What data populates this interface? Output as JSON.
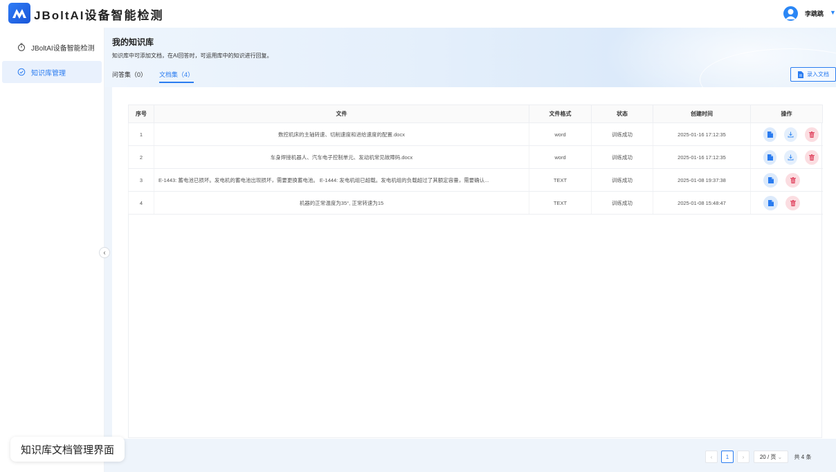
{
  "app": {
    "title": "JBoltAI设备智能检测"
  },
  "user": {
    "name": "李跳跳"
  },
  "sidebar": {
    "items": [
      {
        "label": "JBoltAI设备智能检测",
        "icon": "timer-icon"
      },
      {
        "label": "知识库管理",
        "icon": "knowledge-icon"
      }
    ]
  },
  "page": {
    "title": "我的知识库",
    "description": "知识库中可添加文档，在AI回答时，可运用库中的知识进行回复。",
    "tabs": [
      {
        "label": "问答集（0）"
      },
      {
        "label": "文档集（4）"
      }
    ],
    "import_label": "录入文档"
  },
  "table": {
    "headers": [
      "序号",
      "文件",
      "文件格式",
      "状态",
      "创建时间",
      "操作"
    ],
    "rows": [
      {
        "index": "1",
        "file": "数控机床的主轴转速、切削速度和进给速度的配置.docx",
        "format": "word",
        "status": "训练成功",
        "created": "2025-01-16 17:12:35",
        "ops": [
          "view",
          "download",
          "delete"
        ]
      },
      {
        "index": "2",
        "file": "车身焊接机器人、汽车电子控制单元、发动机常见故障码.docx",
        "format": "word",
        "status": "训练成功",
        "created": "2025-01-16 17:12:35",
        "ops": [
          "view",
          "download",
          "delete"
        ]
      },
      {
        "index": "3",
        "file": "E-1443: 蓄电池已损坏。发电机的蓄电池出现损坏，需要更换蓄电池。 E-1444: 发电机组已超载。发电机组的负载超过了其额定容量，需要确认...",
        "format": "TEXT",
        "status": "训练成功",
        "created": "2025-01-08 19:37:38",
        "ops": [
          "view",
          "delete"
        ]
      },
      {
        "index": "4",
        "file": "机器的正常温度为35°, 正常转速为15",
        "format": "TEXT",
        "status": "训练成功",
        "created": "2025-01-08 15:48:47",
        "ops": [
          "view",
          "delete"
        ]
      }
    ]
  },
  "pagination": {
    "prev": "‹",
    "current": "1",
    "next": "›",
    "page_size": "20 / 页",
    "total": "共 4 条"
  },
  "caption": "知识库文档管理界面",
  "colors": {
    "accent": "#2a7cf0",
    "delete": "#e04862",
    "header_bg": "#eef5fd"
  }
}
